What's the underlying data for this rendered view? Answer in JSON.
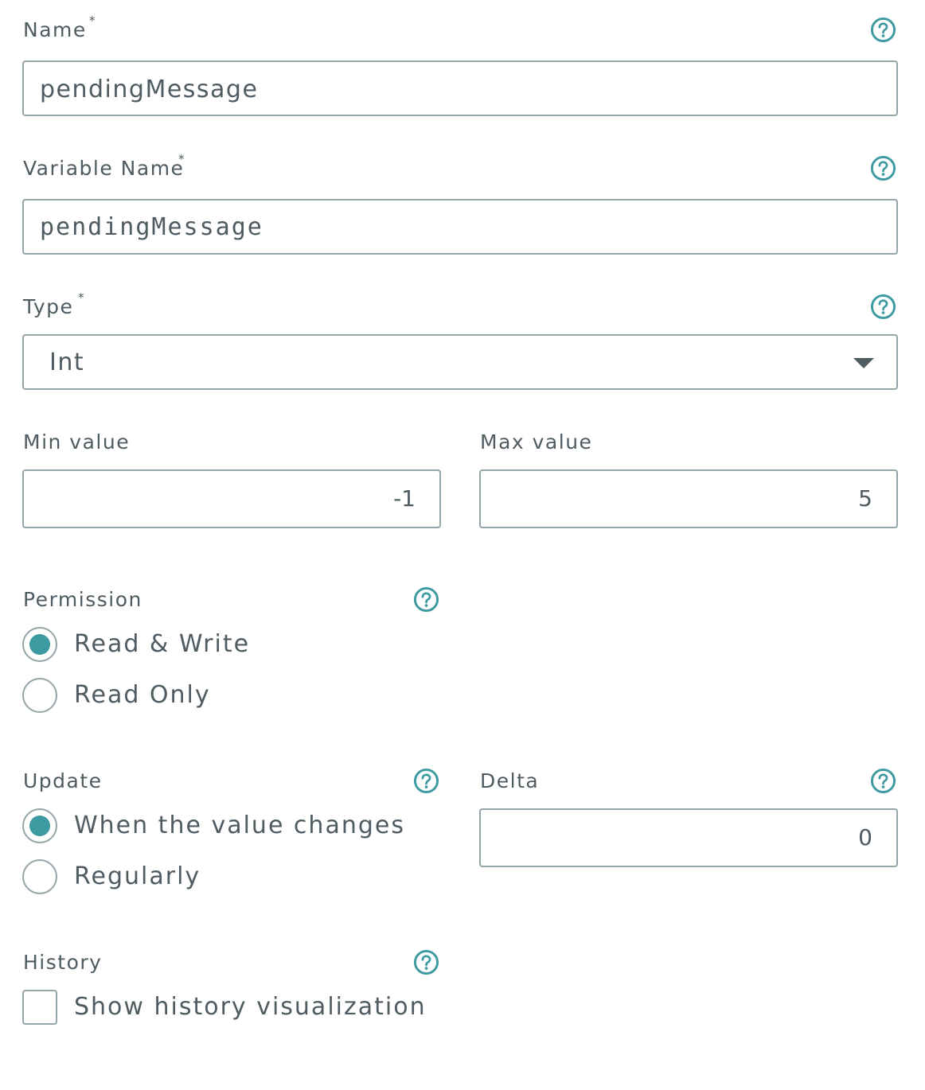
{
  "accent_color": "#3d9aa0",
  "text_color": "#4e5b61",
  "border_color": "#95a4a8",
  "icons": {
    "help": "question-circle-icon",
    "dropdown": "caret-down-icon"
  },
  "name": {
    "label": "Name",
    "required_mark": "*",
    "value": "pendingMessage"
  },
  "variable_name": {
    "label": "Variable Name",
    "required_mark": "*",
    "value": "pendingMessage"
  },
  "type": {
    "label": "Type",
    "required_mark": "*",
    "selected": "Int"
  },
  "min_value": {
    "label": "Min value",
    "value": "-1"
  },
  "max_value": {
    "label": "Max value",
    "value": "5"
  },
  "permission": {
    "label": "Permission",
    "options": [
      {
        "label": "Read & Write",
        "selected": true
      },
      {
        "label": "Read Only",
        "selected": false
      }
    ]
  },
  "update": {
    "label": "Update",
    "options": [
      {
        "label": "When the value changes",
        "selected": true
      },
      {
        "label": "Regularly",
        "selected": false
      }
    ]
  },
  "delta": {
    "label": "Delta",
    "value": "0"
  },
  "history": {
    "label": "History",
    "checkbox_label": "Show history visualization",
    "checked": false
  }
}
